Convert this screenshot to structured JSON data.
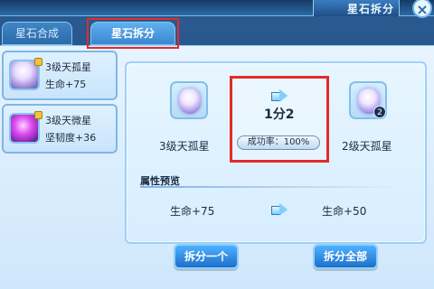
{
  "window": {
    "title": "星石拆分",
    "close_label": "×"
  },
  "tabs": [
    {
      "label": "星石合成"
    },
    {
      "label": "星石拆分"
    }
  ],
  "left_list": {
    "items": [
      {
        "name": "3级天孤星",
        "attr": "生命+75"
      },
      {
        "name": "3级天微星",
        "attr": "坚韧度+36"
      }
    ]
  },
  "split": {
    "from_label": "3级天孤星",
    "to_label": "2级天孤星",
    "ratio": "1分2",
    "success_text": "成功率：100%",
    "to_badge": "2"
  },
  "preview": {
    "title": "属性预览",
    "left_attr": "生命+75",
    "right_attr": "生命+50"
  },
  "buttons": {
    "split_one": "拆分一个",
    "split_all": "拆分全部"
  },
  "colors": {
    "highlight": "#e12b2b",
    "primary_button": "#1e6fc9"
  }
}
